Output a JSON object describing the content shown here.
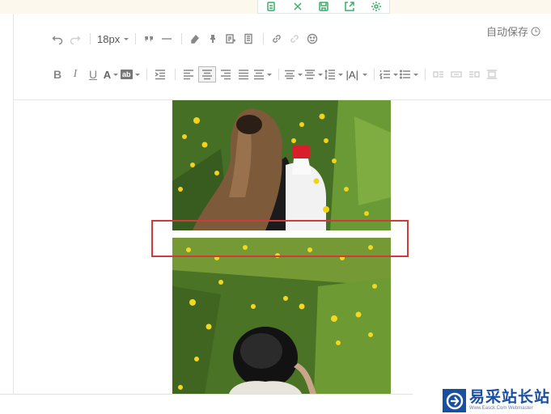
{
  "autosave": {
    "label": "自动保存",
    "icon": "clock-icon"
  },
  "toolbar": {
    "font_size": "18px",
    "bold": "B",
    "italic": "I",
    "underline": "U",
    "font_color": "A",
    "background_color": "ab",
    "letter_spacing": "|A|"
  },
  "float_tools": [
    "copy-icon",
    "crop-icon",
    "save-icon",
    "share-icon",
    "settings-icon"
  ],
  "colors": {
    "accent": "#3cae67",
    "highlight_box": "#cf3b3b",
    "watermark_blue": "#1a4fa0"
  },
  "watermark": {
    "title": "易采站长站",
    "subtitle": "Www.Easck.Com  Webmaster"
  }
}
